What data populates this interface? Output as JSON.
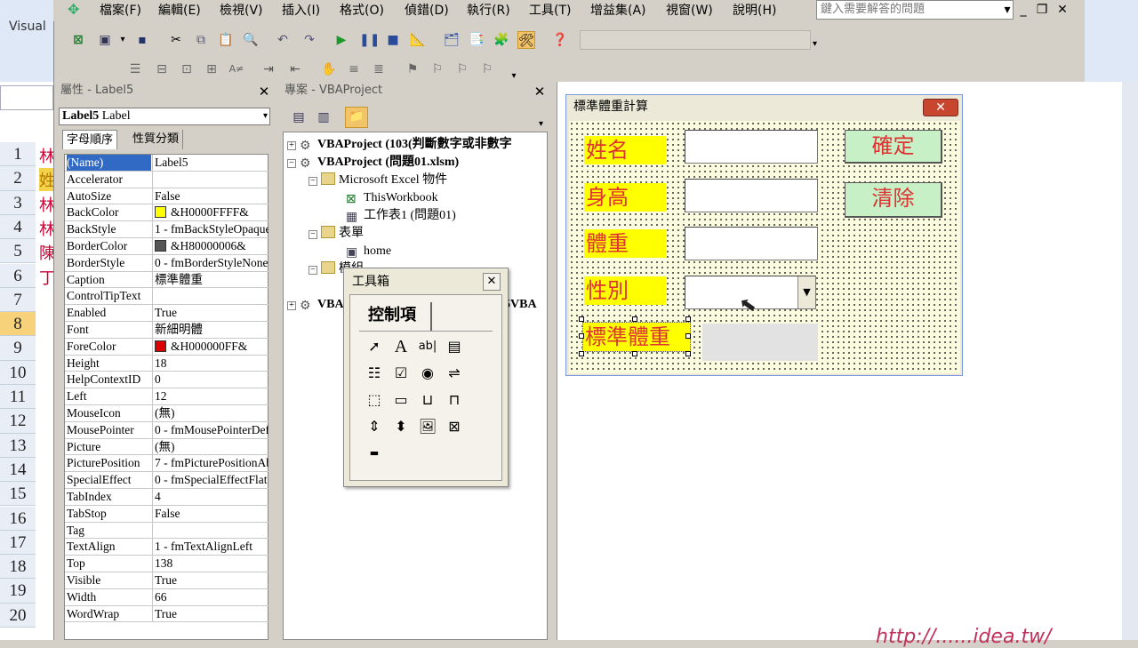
{
  "excel": {
    "app_label": "Visual",
    "rows": [
      "1",
      "2",
      "3",
      "4",
      "5",
      "6",
      "7",
      "8",
      "9",
      "10",
      "11",
      "12",
      "13",
      "14",
      "15",
      "16",
      "17",
      "18",
      "19",
      "20"
    ],
    "selected_row": "8",
    "left_cells": [
      "林",
      "姓",
      "林",
      "林",
      "陳",
      "丁"
    ]
  },
  "menubar": {
    "items": [
      "檔案(F)",
      "編輯(E)",
      "檢視(V)",
      "插入(I)",
      "格式(O)",
      "偵錯(D)",
      "執行(R)",
      "工具(T)",
      "增益集(A)",
      "視窗(W)",
      "說明(H)"
    ],
    "help_placeholder": "鍵入需要解答的問題"
  },
  "properties": {
    "title": "屬性 - Label5",
    "object_name": "Label5",
    "object_type": "Label",
    "tabs": [
      "字母順序",
      "性質分類"
    ],
    "rows": [
      {
        "name": "(Name)",
        "value": "Label5"
      },
      {
        "name": "Accelerator",
        "value": ""
      },
      {
        "name": "AutoSize",
        "value": "False"
      },
      {
        "name": "BackColor",
        "value": "&H0000FFFF&"
      },
      {
        "name": "BackStyle",
        "value": "1 - fmBackStyleOpaque"
      },
      {
        "name": "BorderColor",
        "value": "&H80000006&"
      },
      {
        "name": "BorderStyle",
        "value": "0 - fmBorderStyleNone"
      },
      {
        "name": "Caption",
        "value": "標準體重"
      },
      {
        "name": "ControlTipText",
        "value": ""
      },
      {
        "name": "Enabled",
        "value": "True"
      },
      {
        "name": "Font",
        "value": "新細明體"
      },
      {
        "name": "ForeColor",
        "value": "&H000000FF&"
      },
      {
        "name": "Height",
        "value": "18"
      },
      {
        "name": "HelpContextID",
        "value": "0"
      },
      {
        "name": "Left",
        "value": "12"
      },
      {
        "name": "MouseIcon",
        "value": "(無)"
      },
      {
        "name": "MousePointer",
        "value": "0 - fmMousePointerDefault"
      },
      {
        "name": "Picture",
        "value": "(無)"
      },
      {
        "name": "PicturePosition",
        "value": "7 - fmPicturePositionAboveCenter"
      },
      {
        "name": "SpecialEffect",
        "value": "0 - fmSpecialEffectFlat"
      },
      {
        "name": "TabIndex",
        "value": "4"
      },
      {
        "name": "TabStop",
        "value": "False"
      },
      {
        "name": "Tag",
        "value": ""
      },
      {
        "name": "TextAlign",
        "value": "1 - fmTextAlignLeft"
      },
      {
        "name": "Top",
        "value": "138"
      },
      {
        "name": "Visible",
        "value": "True"
      },
      {
        "name": "Width",
        "value": "66"
      },
      {
        "name": "WordWrap",
        "value": "True"
      }
    ],
    "colors": {
      "backcolor": "#ffff00",
      "bordercolor": "#555555",
      "forecolor": "#dd0000"
    }
  },
  "project": {
    "title": "專案 - VBAProject",
    "nodes": [
      "VBAProject (103(判斷數字或非數字",
      "VBAProject (問題01.xlsm)",
      "Microsoft Excel 物件",
      "ThisWorkbook",
      "工作表1 (問題01)",
      "表單",
      "home",
      "模組",
      "VBAProject (1",
      "5VBA"
    ]
  },
  "userform": {
    "title": "標準體重計算",
    "labels": {
      "name": "姓名",
      "height": "身高",
      "weight": "體重",
      "gender": "性別",
      "standard": "標準體重"
    },
    "buttons": {
      "ok": "確定",
      "clear": "清除"
    }
  },
  "toolbox": {
    "title": "工具箱",
    "tab": "控制項",
    "tools": [
      "select-pointer",
      "label",
      "textbox",
      "combobox",
      "listbox",
      "checkbox",
      "optionbutton",
      "togglebutton",
      "frame",
      "commandbutton",
      "tabstrip",
      "multipage",
      "scrollbar",
      "spinbutton",
      "image",
      "refedit"
    ]
  },
  "watermark": "http://......idea.tw/"
}
